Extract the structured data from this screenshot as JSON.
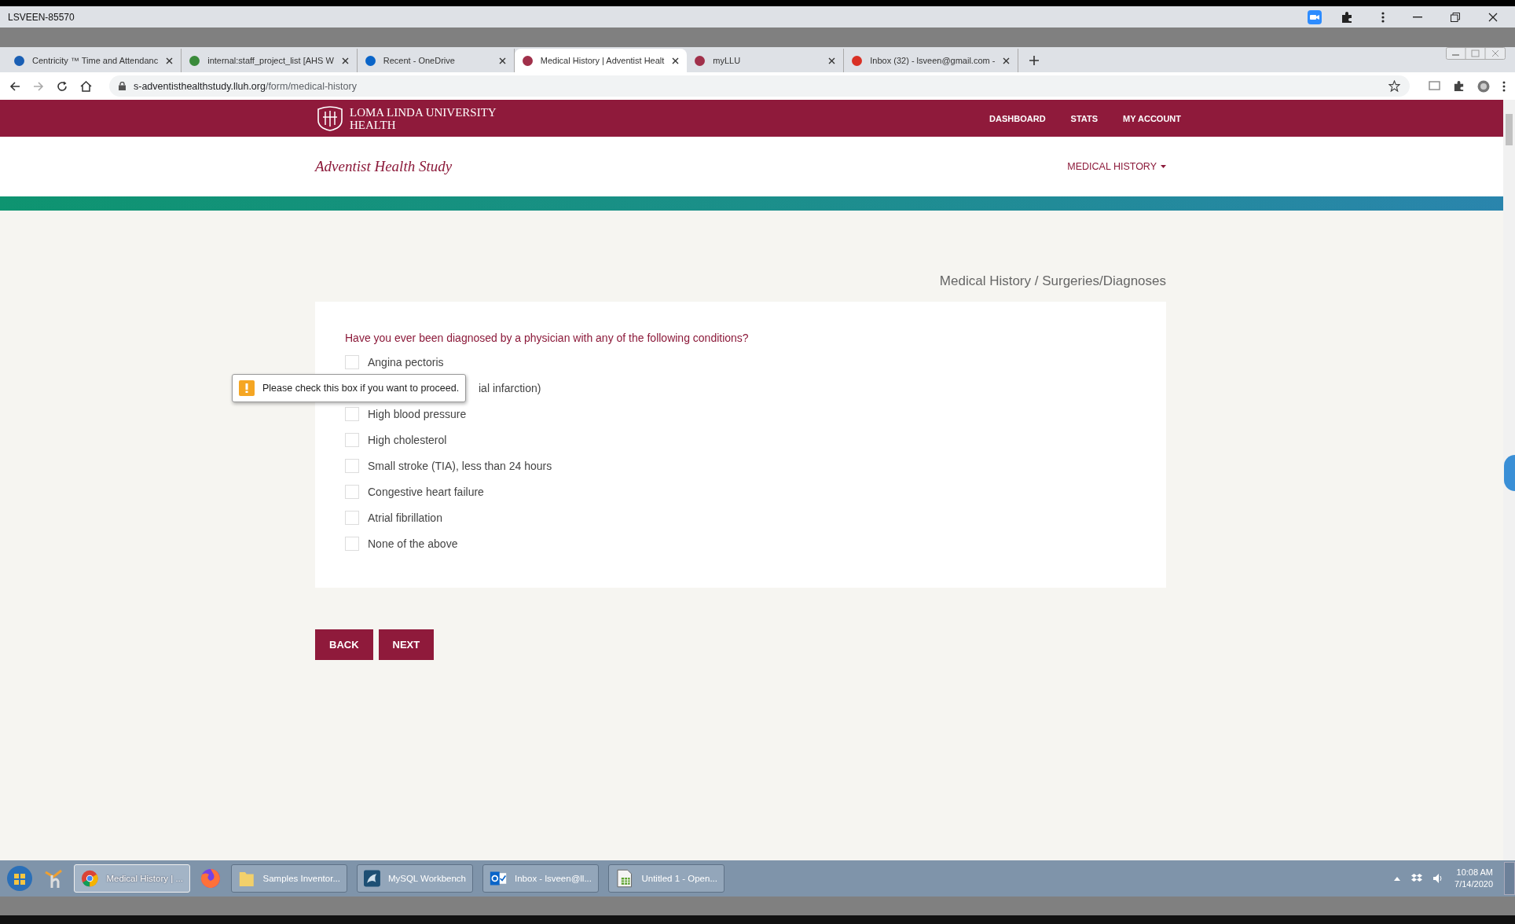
{
  "window": {
    "title": "LSVEEN-85570"
  },
  "tabs": [
    {
      "label": "Centricity ™ Time and Attendanc",
      "selected": false
    },
    {
      "label": "internal:staff_project_list [AHS W",
      "selected": false
    },
    {
      "label": "Recent - OneDrive",
      "selected": false
    },
    {
      "label": "Medical History | Adventist Healt",
      "selected": true
    },
    {
      "label": "myLLU",
      "selected": false
    },
    {
      "label": "Inbox (32) - lsveen@gmail.com -",
      "selected": false
    }
  ],
  "address_bar": {
    "host": "s-adventisthealthstudy.lluh.org",
    "path": "/form/medical-history"
  },
  "site_header": {
    "logo_line_1": "LOMA LINDA UNIVERSITY",
    "logo_line_2": "HEALTH",
    "nav": [
      "DASHBOARD",
      "STATS",
      "MY ACCOUNT"
    ]
  },
  "sub_header": {
    "title": "Adventist Health Study",
    "menu": "MEDICAL HISTORY"
  },
  "breadcrumb": "Medical History / Surgeries/Diagnoses",
  "form": {
    "question": "Have you ever been diagnosed by a physician with any of the following conditions?",
    "options": [
      {
        "label": "Angina pectoris",
        "checked": false,
        "kind": "full"
      },
      {
        "label": "ial infarction)",
        "kind": "obscured"
      },
      {
        "label": "High blood pressure",
        "checked": false,
        "kind": "full"
      },
      {
        "label": "High cholesterol",
        "checked": false,
        "kind": "full"
      },
      {
        "label": "Small stroke (TIA), less than 24 hours",
        "checked": false,
        "kind": "full"
      },
      {
        "label": "Congestive heart failure",
        "checked": false,
        "kind": "full"
      },
      {
        "label": "Atrial fibrillation",
        "checked": false,
        "kind": "full"
      },
      {
        "label": "None of the above",
        "checked": false,
        "kind": "full"
      }
    ],
    "validation_tooltip": "Please check this box if you want to proceed.",
    "buttons": [
      "BACK",
      "NEXT"
    ]
  },
  "taskbar": {
    "items": [
      {
        "label": "Medical History | ...",
        "selected": true
      },
      {
        "label": "Samples Inventor...",
        "selected": false
      },
      {
        "label": "MySQL Workbench",
        "selected": false
      },
      {
        "label": "Inbox - lsveen@ll...",
        "selected": false
      },
      {
        "label": "Untitled 1 - Open...",
        "selected": false
      }
    ],
    "time": "10:08 AM",
    "date": "7/14/2020"
  }
}
